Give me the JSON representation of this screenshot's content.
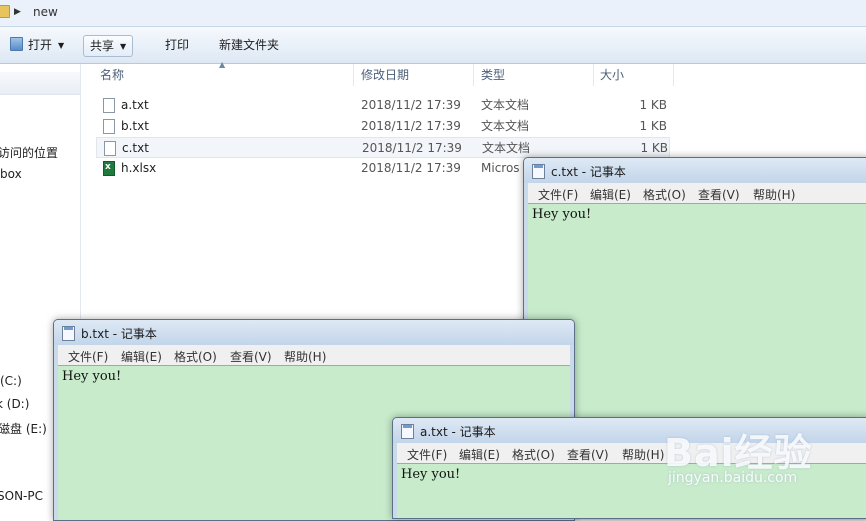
{
  "explorer": {
    "address": {
      "path": "new"
    },
    "toolbar": {
      "open_label": "打开",
      "share_label": "共享",
      "print_label": "打印",
      "new_folder_label": "新建文件夹"
    },
    "nav": {
      "items": [
        {
          "label": "访问的位置"
        },
        {
          "label": "box"
        },
        {
          "label": "(C:)"
        },
        {
          "label": "k (D:)"
        },
        {
          "label": "磁盘 (E:)"
        },
        {
          "label": "SON-PC"
        }
      ]
    },
    "columns": {
      "name": "名称",
      "date": "修改日期",
      "type": "类型",
      "size": "大小"
    },
    "files": [
      {
        "name": "a.txt",
        "date": "2018/11/2 17:39",
        "type": "文本文档",
        "size": "1 KB",
        "icon": "text-file-icon"
      },
      {
        "name": "b.txt",
        "date": "2018/11/2 17:39",
        "type": "文本文档",
        "size": "1 KB",
        "icon": "text-file-icon"
      },
      {
        "name": "c.txt",
        "date": "2018/11/2 17:39",
        "type": "文本文档",
        "size": "1 KB",
        "icon": "text-file-icon",
        "selected": true
      },
      {
        "name": "h.xlsx",
        "date": "2018/11/2 17:39",
        "type": "Micros",
        "size": "",
        "icon": "excel-file-icon"
      }
    ]
  },
  "notepad_menu": {
    "file": "文件(F)",
    "edit": "编辑(E)",
    "format": "格式(O)",
    "view": "查看(V)",
    "help": "帮助(H)"
  },
  "notepads": {
    "c": {
      "title": "c.txt - 记事本",
      "content": "Hey you!"
    },
    "b": {
      "title": "b.txt - 记事本",
      "content": "Hey you!"
    },
    "a": {
      "title": "a.txt - 记事本",
      "content": "Hey you!"
    }
  },
  "watermark": {
    "brand": "Bai经验",
    "url": "jingyan.baidu.com"
  },
  "colors": {
    "notepad_bg": "#c7ebcb",
    "titlebar": "#c2d5ea"
  }
}
